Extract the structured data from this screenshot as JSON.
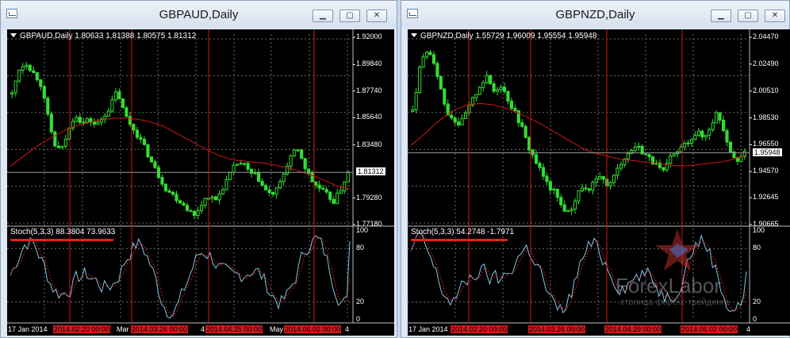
{
  "windows": [
    {
      "title": "GBPAUD,Daily",
      "header": "GBPAUD,Daily  1.80633 1.81388 1.80575 1.81312",
      "price_ticks": [
        "1.92000",
        "1.89840",
        "1.87740",
        "1.85640",
        "1.83480",
        "1.81312",
        "1.79280",
        "1.77180"
      ],
      "current_price": "1.81312",
      "stoch_label": "Stoch(5,3,3) 88.3804 73.9633",
      "stoch_ticks": [
        "100",
        "80",
        "20",
        "0"
      ],
      "date_labels": [
        {
          "text": "17 Jan 2014",
          "red": false
        },
        {
          "text": "2014.02.20 00:00",
          "red": true
        },
        {
          "text": "Mar",
          "red": false
        },
        {
          "text": "2014.03.26 00:00",
          "red": true
        },
        {
          "text": "4",
          "red": false
        },
        {
          "text": "2014.04.25 00:00",
          "red": true
        },
        {
          "text": "May",
          "red": false
        },
        {
          "text": "2014.06.02 00:00",
          "red": true
        },
        {
          "text": "4",
          "red": false
        }
      ]
    },
    {
      "title": "GBPNZD,Daily",
      "header": "GBPNZD,Daily  1.55729 1.96009 1.95554 1.95948",
      "price_ticks": [
        "2.04470",
        "2.02490",
        "2.00510",
        "1.98530",
        "1.96550",
        "1.95948",
        "1.94570",
        "1.92645",
        "1.90665"
      ],
      "current_price": "1.95948",
      "stoch_label": "Stoch(5,3,3) 54.2748 -1.7971",
      "stoch_ticks": [
        "100",
        "80",
        "20",
        "0"
      ],
      "date_labels": [
        {
          "text": "17 Jan 2014",
          "red": false
        },
        {
          "text": "2014.02.20 00:00",
          "red": true
        },
        {
          "text": "2014.03.26 00:00",
          "red": true
        },
        {
          "text": "2014.04.29 00:00",
          "red": true
        },
        {
          "text": "2014.06.02 00:00",
          "red": true
        },
        {
          "text": "4",
          "red": false
        }
      ],
      "watermark": "ForexLabor",
      "watermark_sub": "столица форекс трейдинга"
    }
  ],
  "window_buttons": {
    "minimize": "▁",
    "maximize": "▢",
    "close": "✕"
  },
  "colors": {
    "candle": "#33dd33",
    "ma": "#d11818",
    "stoch_main": "#7fc8e6",
    "stoch_signal": "#d11818",
    "vline": "#d11818",
    "grid": "#6b6b6b",
    "bg": "#000000"
  },
  "chart_data": [
    {
      "type": "candlestick",
      "symbol": "GBPAUD",
      "timeframe": "Daily",
      "ylim": [
        1.7718,
        1.92
      ],
      "close_path": [
        1.875,
        1.895,
        1.9,
        1.892,
        1.885,
        1.86,
        1.835,
        1.83,
        1.845,
        1.86,
        1.852,
        1.855,
        1.85,
        1.857,
        1.865,
        1.878,
        1.86,
        1.85,
        1.842,
        1.832,
        1.82,
        1.81,
        1.8,
        1.795,
        1.79,
        1.785,
        1.778,
        1.788,
        1.795,
        1.79,
        1.8,
        1.81,
        1.82,
        1.82,
        1.812,
        1.81,
        1.8,
        1.795,
        1.8,
        1.815,
        1.828,
        1.83,
        1.815,
        1.805,
        1.8,
        1.795,
        1.79,
        1.8,
        1.813
      ],
      "ma_path": [
        1.818,
        1.825,
        1.832,
        1.838,
        1.843,
        1.848,
        1.851,
        1.853,
        1.855,
        1.856,
        1.856,
        1.855,
        1.853,
        1.85,
        1.845,
        1.84,
        1.835,
        1.83,
        1.826,
        1.823,
        1.822,
        1.821,
        1.82,
        1.818,
        1.816,
        1.813,
        1.81,
        1.806,
        1.802,
        1.8
      ],
      "stochastic": {
        "main": 88.3804,
        "signal": 73.9633,
        "levels": [
          80,
          20
        ]
      }
    },
    {
      "type": "candlestick",
      "symbol": "GBPNZD",
      "timeframe": "Daily",
      "ylim": [
        1.90665,
        2.0447
      ],
      "close_path": [
        1.99,
        2.02,
        2.035,
        2.03,
        2.01,
        1.99,
        1.985,
        1.98,
        1.99,
        2.0,
        2.01,
        2.015,
        2.005,
        2.01,
        2.0,
        1.99,
        1.98,
        1.965,
        1.955,
        1.945,
        1.935,
        1.93,
        1.92,
        1.915,
        1.925,
        1.935,
        1.93,
        1.94,
        1.94,
        1.935,
        1.945,
        1.955,
        1.96,
        1.965,
        1.96,
        1.955,
        1.95,
        1.945,
        1.955,
        1.96,
        1.965,
        1.97,
        1.975,
        1.97,
        1.98,
        1.99,
        1.975,
        1.96,
        1.955,
        1.959
      ],
      "ma_path": [
        1.965,
        1.972,
        1.98,
        1.987,
        1.992,
        1.995,
        1.996,
        1.995,
        1.993,
        1.99,
        1.986,
        1.982,
        1.977,
        1.972,
        1.967,
        1.962,
        1.959,
        1.957,
        1.955,
        1.954,
        1.953,
        1.952,
        1.951,
        1.95,
        1.95,
        1.951,
        1.952,
        1.953,
        1.955,
        1.958
      ],
      "stochastic": {
        "main": 54.2748,
        "signal": -1.7971,
        "levels": [
          80,
          20
        ]
      }
    }
  ]
}
